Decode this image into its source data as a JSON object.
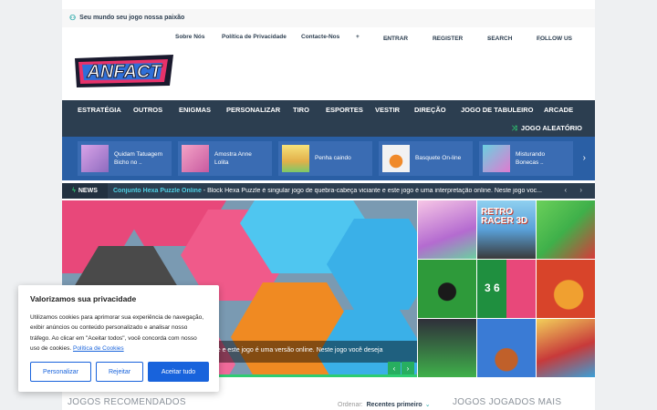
{
  "topbar": {
    "tagline": "Seu mundo seu jogo nossa paixão"
  },
  "secondary_nav": {
    "about": "Sobre Nós",
    "privacy": "Política de Privacidade",
    "contact": "Contacte-Nos",
    "plus": "+",
    "login": "ENTRAR",
    "register": "REGISTER",
    "search": "SEARCH",
    "follow": "FOLLOW US"
  },
  "logo": {
    "text": "ANFACT"
  },
  "main_nav": {
    "items": [
      "ESTRATÉGIA",
      "OUTROS",
      "ENIGMAS",
      "PERSONALIZAR",
      "TIRO",
      "ESPORTES",
      "VESTIR",
      "DIREÇÃO",
      "JOGO DE TABULEIRO",
      "ARCADE"
    ],
    "random_game": "JOGO ALEATÓRIO"
  },
  "carousel": {
    "games": [
      {
        "title_line1": "Quidam Tatuagem",
        "title_line2": "Bicho no ..",
        "color": "#8e6bbf"
      },
      {
        "title_line1": "Amostra Anne",
        "title_line2": "Lolita",
        "color": "#c85aa0"
      },
      {
        "title_line1": "Penha caindo",
        "title_line2": "",
        "color": "#e2b04a"
      },
      {
        "title_line1": "Basquete On-line",
        "title_line2": "",
        "color": "#f2f2f2"
      },
      {
        "title_line1": "Misturando",
        "title_line2": "Bonecas ..",
        "color": "#6bd0e0"
      }
    ]
  },
  "news": {
    "label": "NEWS",
    "headline": "Conjunto Hexa Puzzle Online",
    "text": " - Block Hexa Puzzle é singular jogo de quebra-cabeça viciante e este jogo é uma interpretação online. Neste jogo voc..."
  },
  "hero": {
    "caption": "ante e este jogo é uma versão online. Neste jogo você deseja"
  },
  "grid_tiles": [
    {
      "label": "",
      "color": "#b46bd0"
    },
    {
      "label": "RETRO RACER 3D",
      "color": "#5aa0d8"
    },
    {
      "label": "",
      "color": "#3fb04a"
    },
    {
      "label": "",
      "color": "#2e9a3a"
    },
    {
      "label": "3 6",
      "color": "#1f8f3f"
    },
    {
      "label": "",
      "color": "#d8442a"
    },
    {
      "label": "",
      "color": "#2f2f3a"
    },
    {
      "label": "",
      "color": "#3a7bd5"
    },
    {
      "label": "",
      "color": "#c83a3a"
    }
  ],
  "sections": {
    "recommended": "JOGOS RECOMENDADOS",
    "sort_label": "Ordenar:",
    "sort_value": "Recentes primeiro",
    "most_played": "JOGOS JOGADOS MAIS"
  },
  "cookie": {
    "title": "Valorizamos sua privacidade",
    "body": "Utilizamos cookies para aprimorar sua experiência de navegação, exibir anúncios ou conteúdo personalizado e analisar nosso tráfego. Ao clicar em \"Aceitar todos\", você concorda com nosso uso de cookies.",
    "policy_link": "Política de Cookies",
    "customize": "Personalizar",
    "reject": "Rejeitar",
    "accept": "Aceitar tudo"
  },
  "colors": {
    "nav": "#2c3e50",
    "carousel": "#2a5fa5",
    "accent": "#2ecc71",
    "cookie_blue": "#1863dc"
  }
}
